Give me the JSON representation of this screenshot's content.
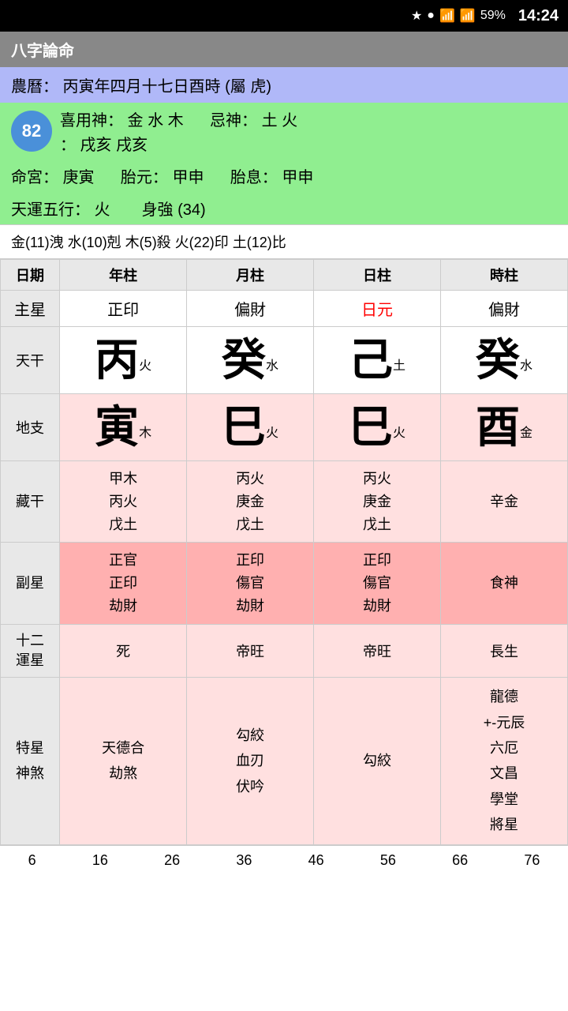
{
  "statusBar": {
    "battery": "59%",
    "time": "14:24"
  },
  "appTitle": "八字論命",
  "lunarDate": "農曆： 丙寅年四月十七日酉時 (屬 虎)",
  "xiyong": "喜用神：  金 水 木",
  "jiShen": "忌神： 土 火",
  "score": "82",
  "nayin": "：  戌亥 戌亥",
  "mingong": "命宮：  庚寅",
  "taiyuan": "胎元：  甲申",
  "taixi": "胎息：  甲申",
  "tianyun": "天運五行：  火",
  "shengqiang": "身強 (34)",
  "elements": "金(11)洩  水(10)剋  木(5)殺  火(22)印  土(12)比",
  "tableHeaders": [
    "日期",
    "年柱",
    "月柱",
    "日柱",
    "時柱"
  ],
  "zhuxing": [
    "主星",
    "正印",
    "偏財",
    "日元",
    "偏財"
  ],
  "tiangan": {
    "label": "天干",
    "nian": {
      "char": "丙",
      "sub": "火"
    },
    "yue": {
      "char": "癸",
      "sub": "水"
    },
    "ri": {
      "char": "己",
      "sub": "土"
    },
    "shi": {
      "char": "癸",
      "sub": "水"
    }
  },
  "dizhi": {
    "label": "地支",
    "nian": {
      "char": "寅",
      "sub": "木"
    },
    "yue": {
      "char": "巳",
      "sub": "火"
    },
    "ri": {
      "char": "巳",
      "sub": "火"
    },
    "shi": {
      "char": "酉",
      "sub": "金"
    }
  },
  "canggan": {
    "label": "藏干",
    "nian": "甲木\n丙火\n戊土",
    "yue": "丙火\n庚金\n戊土",
    "ri": "丙火\n庚金\n戊土",
    "shi": "辛金"
  },
  "fuxing": {
    "label": "副星",
    "nian": "正官\n正印\n劫財",
    "yue": "正印\n傷官\n劫財",
    "ri": "正印\n傷官\n劫財",
    "shi": "食神"
  },
  "shierxing": {
    "label": "十二\n運星",
    "nian": "死",
    "yue": "帝旺",
    "ri": "帝旺",
    "shi": "長生"
  },
  "texing": {
    "label": "特星\n神煞",
    "nian": "天德合\n劫煞",
    "yue": "勾絞\n血刃\n伏吟",
    "ri": "勾絞",
    "shi": "龍德\n+-元辰\n六厄\n文昌\n學堂\n將星"
  },
  "bottomNumbers": [
    "6",
    "16",
    "26",
    "36",
    "46",
    "56",
    "66",
    "76"
  ]
}
